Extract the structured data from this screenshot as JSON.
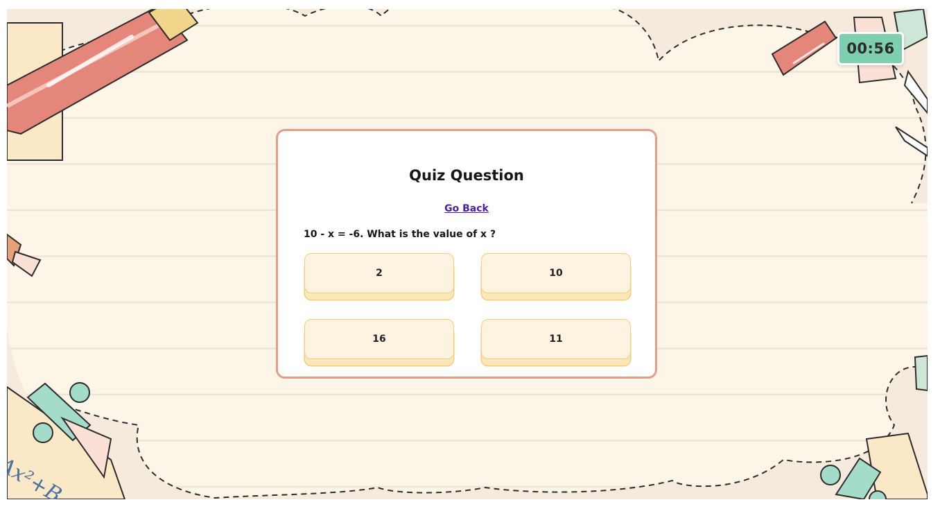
{
  "timer": {
    "value": "00:56"
  },
  "quiz": {
    "title": "Quiz Question",
    "back_label": "Go Back",
    "question": "10 - x = -6. What is the value of x ?",
    "answers": [
      "2",
      "10",
      "16",
      "11"
    ]
  },
  "decor": {
    "formula": "Ax²+B",
    "icons": [
      "pencil-icon",
      "ruler-icon",
      "set-square-icon",
      "eraser-icon",
      "tack-icon"
    ]
  },
  "colors": {
    "background": "#fdf6e8",
    "card_border": "#e79a88",
    "answer_fill": "#fdf3e0",
    "answer_border": "#f2cd79",
    "timer_fill": "#7ecfb0",
    "link": "#4b1fa6"
  }
}
